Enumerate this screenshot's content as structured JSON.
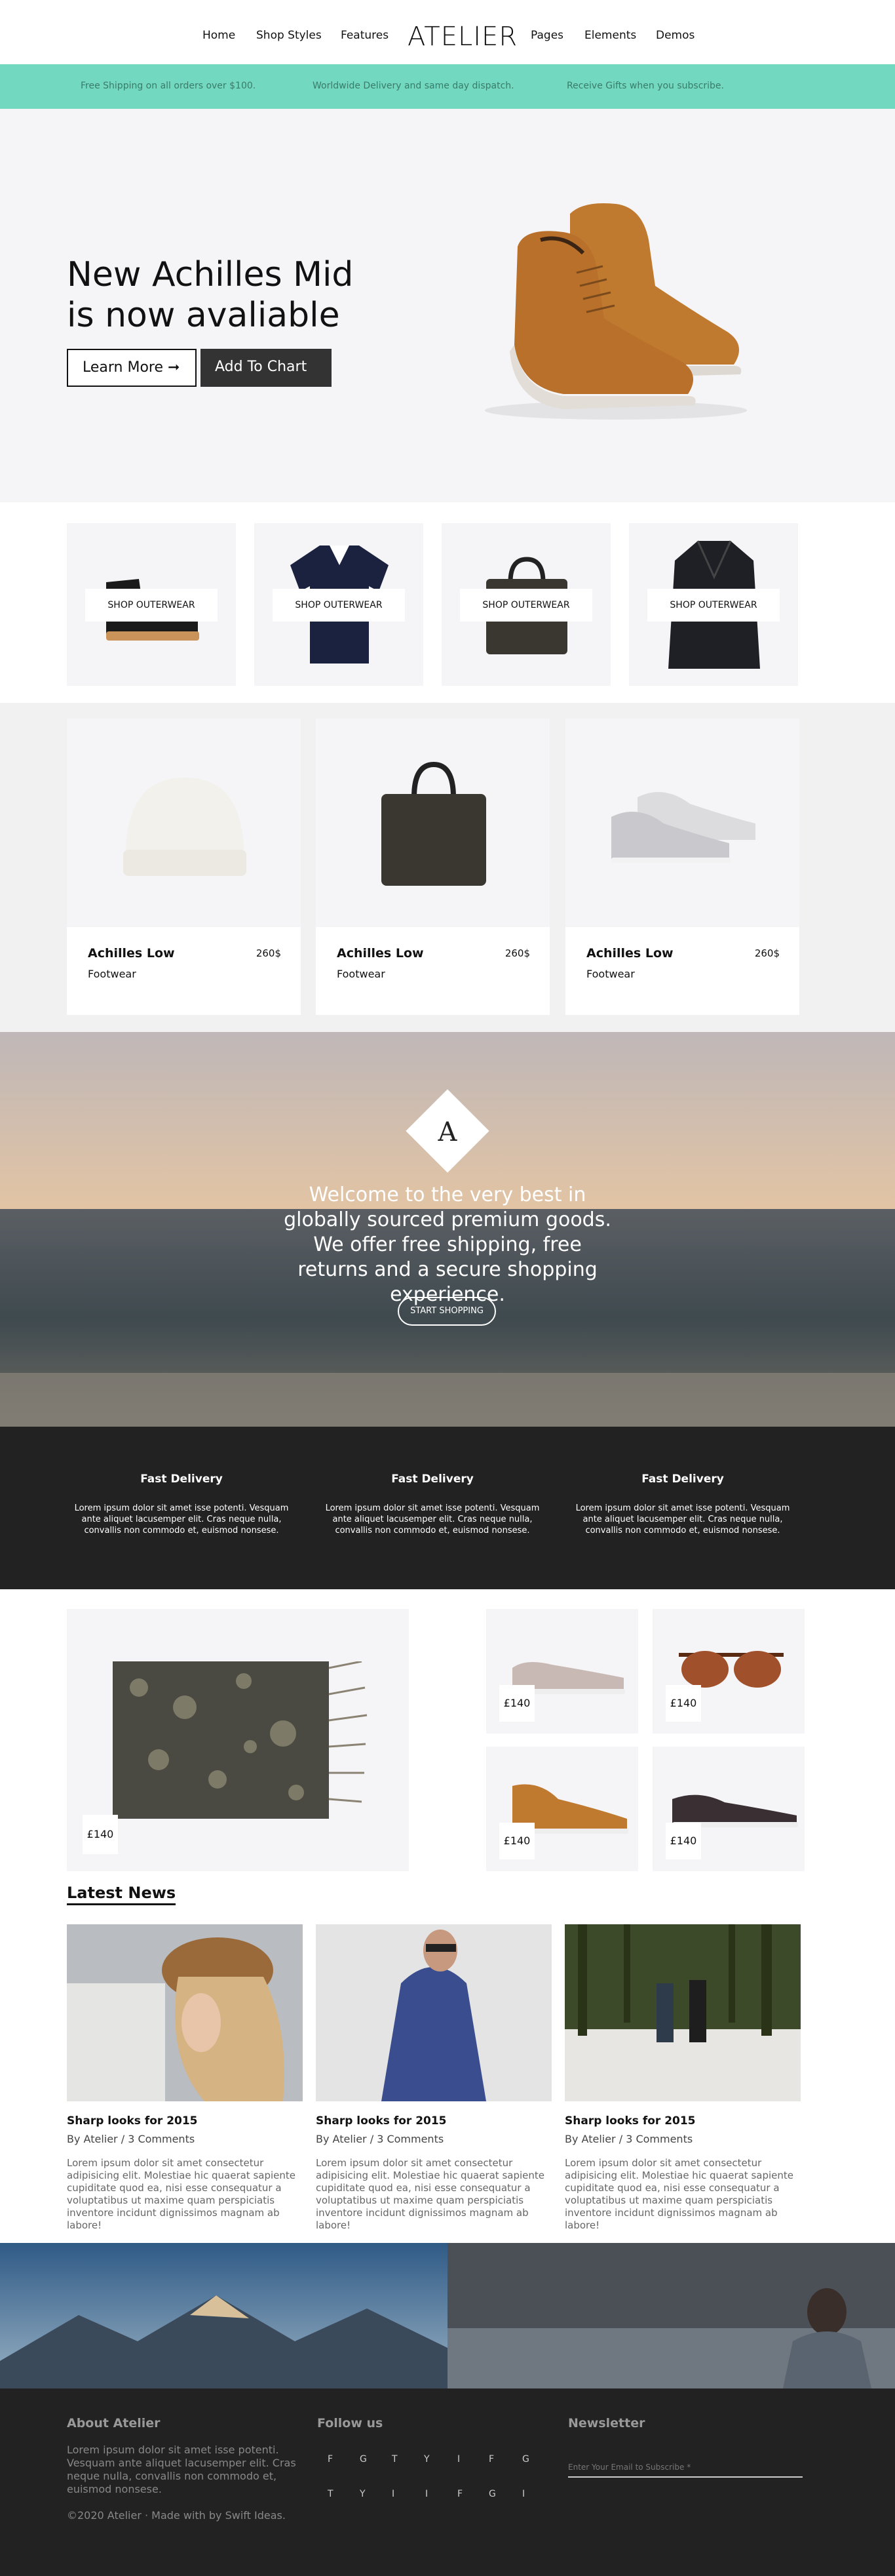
{
  "header": {
    "logo": "ATELIER",
    "nav": [
      "Home",
      "Shop Styles",
      "Features",
      "Pages",
      "Elements",
      "Demos"
    ]
  },
  "promo": [
    "Free Shipping on all orders over $100.",
    "Worldwide Delivery and same day dispatch.",
    "Receive Gifts when you subscribe."
  ],
  "hero": {
    "title_line1": "New Achilles Mid",
    "title_line2": "is now avaliable",
    "learn_more": "Learn More ➞",
    "add_to_chart": "Add To Chart"
  },
  "categories": [
    {
      "label": "SHOP OUTERWEAR",
      "icon": "boot-icon"
    },
    {
      "label": "SHOP OUTERWEAR",
      "icon": "polo-shirt-icon"
    },
    {
      "label": "SHOP OUTERWEAR",
      "icon": "bag-icon"
    },
    {
      "label": "SHOP OUTERWEAR",
      "icon": "coat-icon"
    }
  ],
  "products": [
    {
      "name": "Achilles Low",
      "price": "260$",
      "category": "Footwear",
      "icon": "beanie-icon"
    },
    {
      "name": "Achilles Low",
      "price": "260$",
      "category": "Footwear",
      "icon": "bag-icon"
    },
    {
      "name": "Achilles Low",
      "price": "260$",
      "category": "Footwear",
      "icon": "sneakers-icon"
    }
  ],
  "banner": {
    "emblem": "A",
    "text": "Welcome to the very best in globally sourced premium goods. We offer free shipping, free returns and a secure shopping experience.",
    "button": "START SHOPPING"
  },
  "features": [
    {
      "title": "Fast Delivery",
      "body": "Lorem ipsum dolor sit amet isse potenti. Vesquam ante aliquet lacusemper elit. Cras neque nulla, convallis non commodo et, euismod nonsese."
    },
    {
      "title": "Fast Delivery",
      "body": "Lorem ipsum dolor sit amet isse potenti. Vesquam ante aliquet lacusemper elit. Cras neque nulla, convallis non commodo et, euismod nonsese."
    },
    {
      "title": "Fast Delivery",
      "body": "Lorem ipsum dolor sit amet isse potenti. Vesquam ante aliquet lacusemper elit. Cras neque nulla, convallis non commodo et, euismod nonsese."
    }
  ],
  "shop": {
    "large_price": "£140",
    "small": [
      {
        "price": "£140",
        "icon": "slip-on-shoe-icon"
      },
      {
        "price": "£140",
        "icon": "sunglasses-icon"
      },
      {
        "price": "£140",
        "icon": "tan-sneaker-icon"
      },
      {
        "price": "£140",
        "icon": "dark-sneaker-icon"
      }
    ]
  },
  "news": {
    "heading": "Latest News",
    "items": [
      {
        "title": "Sharp looks for 2015",
        "meta": "By Atelier / 3 Comments",
        "body": "Lorem ipsum dolor sit amet consectetur adipisicing elit. Molestiae hic quaerat sapiente cupiditate quod ea, nisi esse consequatur a voluptatibus ut maxime quam perspiciatis inventore incidunt dignissimos magnam ab labore!"
      },
      {
        "title": "Sharp looks for 2015",
        "meta": "By Atelier / 3 Comments",
        "body": "Lorem ipsum dolor sit amet consectetur adipisicing elit. Molestiae hic quaerat sapiente cupiditate quod ea, nisi esse consequatur a voluptatibus ut maxime quam perspiciatis inventore incidunt dignissimos magnam ab labore!"
      },
      {
        "title": "Sharp looks for 2015",
        "meta": "By Atelier / 3 Comments",
        "body": "Lorem ipsum dolor sit amet consectetur adipisicing elit. Molestiae hic quaerat sapiente cupiditate quod ea, nisi esse consequatur a voluptatibus ut maxime quam perspiciatis inventore incidunt dignissimos magnam ab labore!"
      }
    ]
  },
  "footer": {
    "about_title": "About Atelier",
    "about_text": "Lorem ipsum dolor sit amet isse potenti. Vesquam ante aliquet lacusemper elit. Cras neque nulla, convallis non commodo et, euismod nonsese.",
    "follow_title": "Follow us",
    "social_row1": [
      "F",
      "G",
      "T",
      "Y",
      "I",
      "F",
      "G"
    ],
    "social_row2": [
      "T",
      "Y",
      "I",
      "I",
      "F",
      "G",
      "I"
    ],
    "newsletter_title": "Newsletter",
    "newsletter_placeholder": "Enter Your Email to Subscribe *",
    "copyright": "©2020 Atelier · Made with by Swift Ideas."
  },
  "colors": {
    "promo_bg": "#72d8bf",
    "light_bg": "#f5f4f6",
    "dark_bg": "#222222",
    "accent_dark": "#333333"
  }
}
